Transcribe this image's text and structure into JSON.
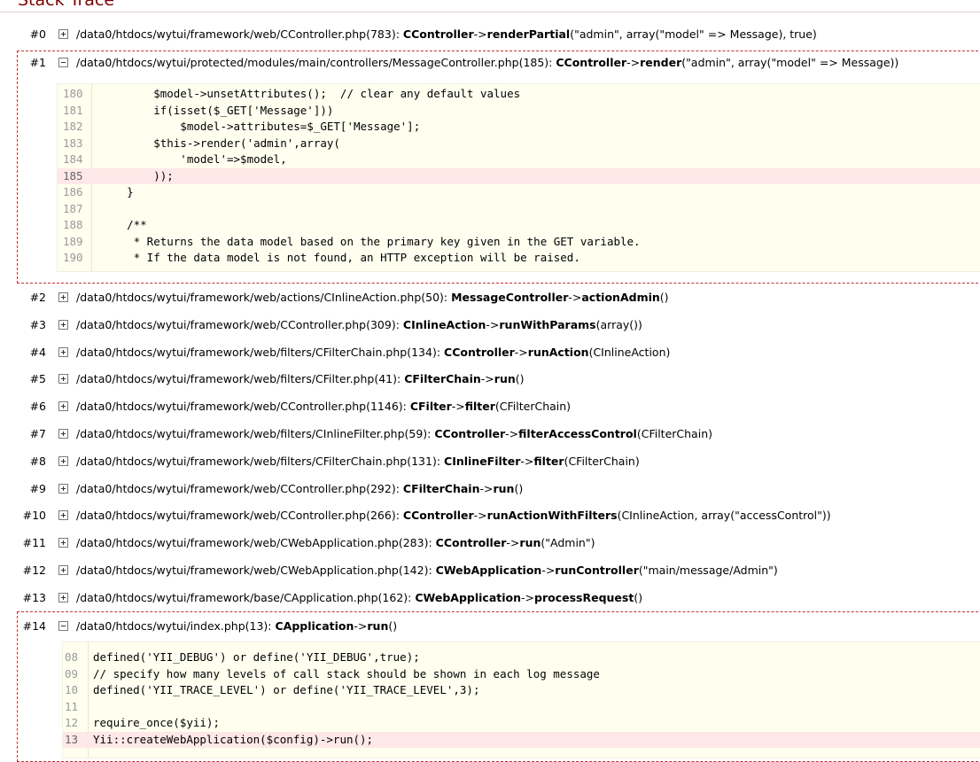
{
  "page": {
    "title": "Stack Trace"
  },
  "trace": [
    {
      "num": "#0",
      "path": "/data0/htdocs/wytui/framework/web/CController.php(783): ",
      "cls": "CController",
      "arrow": "->",
      "method": "renderPartial",
      "args": "(\"admin\", array(\"model\" => Message), true)"
    },
    {
      "num": "#1",
      "path": "/data0/htdocs/wytui/protected/modules/main/controllers/MessageController.php(185): ",
      "cls": "CController",
      "arrow": "->",
      "method": "render",
      "args": "(\"admin\", array(\"model\" => Message))"
    },
    {
      "num": "#2",
      "path": "/data0/htdocs/wytui/framework/web/actions/CInlineAction.php(50): ",
      "cls": "MessageController",
      "arrow": "->",
      "method": "actionAdmin",
      "args": "()"
    },
    {
      "num": "#3",
      "path": "/data0/htdocs/wytui/framework/web/CController.php(309): ",
      "cls": "CInlineAction",
      "arrow": "->",
      "method": "runWithParams",
      "args": "(array())"
    },
    {
      "num": "#4",
      "path": "/data0/htdocs/wytui/framework/web/filters/CFilterChain.php(134): ",
      "cls": "CController",
      "arrow": "->",
      "method": "runAction",
      "args": "(CInlineAction)"
    },
    {
      "num": "#5",
      "path": "/data0/htdocs/wytui/framework/web/filters/CFilter.php(41): ",
      "cls": "CFilterChain",
      "arrow": "->",
      "method": "run",
      "args": "()"
    },
    {
      "num": "#6",
      "path": "/data0/htdocs/wytui/framework/web/CController.php(1146): ",
      "cls": "CFilter",
      "arrow": "->",
      "method": "filter",
      "args": "(CFilterChain)"
    },
    {
      "num": "#7",
      "path": "/data0/htdocs/wytui/framework/web/filters/CInlineFilter.php(59): ",
      "cls": "CController",
      "arrow": "->",
      "method": "filterAccessControl",
      "args": "(CFilterChain)"
    },
    {
      "num": "#8",
      "path": "/data0/htdocs/wytui/framework/web/filters/CFilterChain.php(131): ",
      "cls": "CInlineFilter",
      "arrow": "->",
      "method": "filter",
      "args": "(CFilterChain)"
    },
    {
      "num": "#9",
      "path": "/data0/htdocs/wytui/framework/web/CController.php(292): ",
      "cls": "CFilterChain",
      "arrow": "->",
      "method": "run",
      "args": "()"
    },
    {
      "num": "#10",
      "path": "/data0/htdocs/wytui/framework/web/CController.php(266): ",
      "cls": "CController",
      "arrow": "->",
      "method": "runActionWithFilters",
      "args": "(CInlineAction, array(\"accessControl\"))"
    },
    {
      "num": "#11",
      "path": "/data0/htdocs/wytui/framework/web/CWebApplication.php(283): ",
      "cls": "CController",
      "arrow": "->",
      "method": "run",
      "args": "(\"Admin\")"
    },
    {
      "num": "#12",
      "path": "/data0/htdocs/wytui/framework/web/CWebApplication.php(142): ",
      "cls": "CWebApplication",
      "arrow": "->",
      "method": "runController",
      "args": "(\"main/message/Admin\")"
    },
    {
      "num": "#13",
      "path": "/data0/htdocs/wytui/framework/base/CApplication.php(162): ",
      "cls": "CWebApplication",
      "arrow": "->",
      "method": "processRequest",
      "args": "()"
    },
    {
      "num": "#14",
      "path": "/data0/htdocs/wytui/index.php(13): ",
      "cls": "CApplication",
      "arrow": "->",
      "method": "run",
      "args": "()"
    }
  ],
  "code1": [
    {
      "ln": "180",
      "src": "        $model->unsetAttributes();  // clear any default values",
      "hl": false
    },
    {
      "ln": "181",
      "src": "        if(isset($_GET['Message']))",
      "hl": false
    },
    {
      "ln": "182",
      "src": "            $model->attributes=$_GET['Message'];",
      "hl": false
    },
    {
      "ln": "183",
      "src": "        $this->render('admin',array(",
      "hl": false
    },
    {
      "ln": "184",
      "src": "            'model'=>$model,",
      "hl": false
    },
    {
      "ln": "185",
      "src": "        ));",
      "hl": true
    },
    {
      "ln": "186",
      "src": "    }",
      "hl": false
    },
    {
      "ln": "187",
      "src": "",
      "hl": false
    },
    {
      "ln": "188",
      "src": "    /**",
      "hl": false
    },
    {
      "ln": "189",
      "src": "     * Returns the data model based on the primary key given in the GET variable.",
      "hl": false
    },
    {
      "ln": "190",
      "src": "     * If the data model is not found, an HTTP exception will be raised.",
      "hl": false
    }
  ],
  "code2": [
    {
      "ln": "08",
      "src": "defined('YII_DEBUG') or define('YII_DEBUG',true);",
      "hl": false
    },
    {
      "ln": "09",
      "src": "// specify how many levels of call stack should be shown in each log message",
      "hl": false
    },
    {
      "ln": "10",
      "src": "defined('YII_TRACE_LEVEL') or define('YII_TRACE_LEVEL',3);",
      "hl": false
    },
    {
      "ln": "11",
      "src": "",
      "hl": false
    },
    {
      "ln": "12",
      "src": "require_once($yii);",
      "hl": false
    },
    {
      "ln": "13",
      "src": "Yii::createWebApplication($config)->run();",
      "hl": true
    }
  ],
  "colors": {
    "title": "#800000",
    "highlight": "#ffe8e8",
    "code_bg": "#fffff0",
    "dashed_border": "#c03030"
  }
}
